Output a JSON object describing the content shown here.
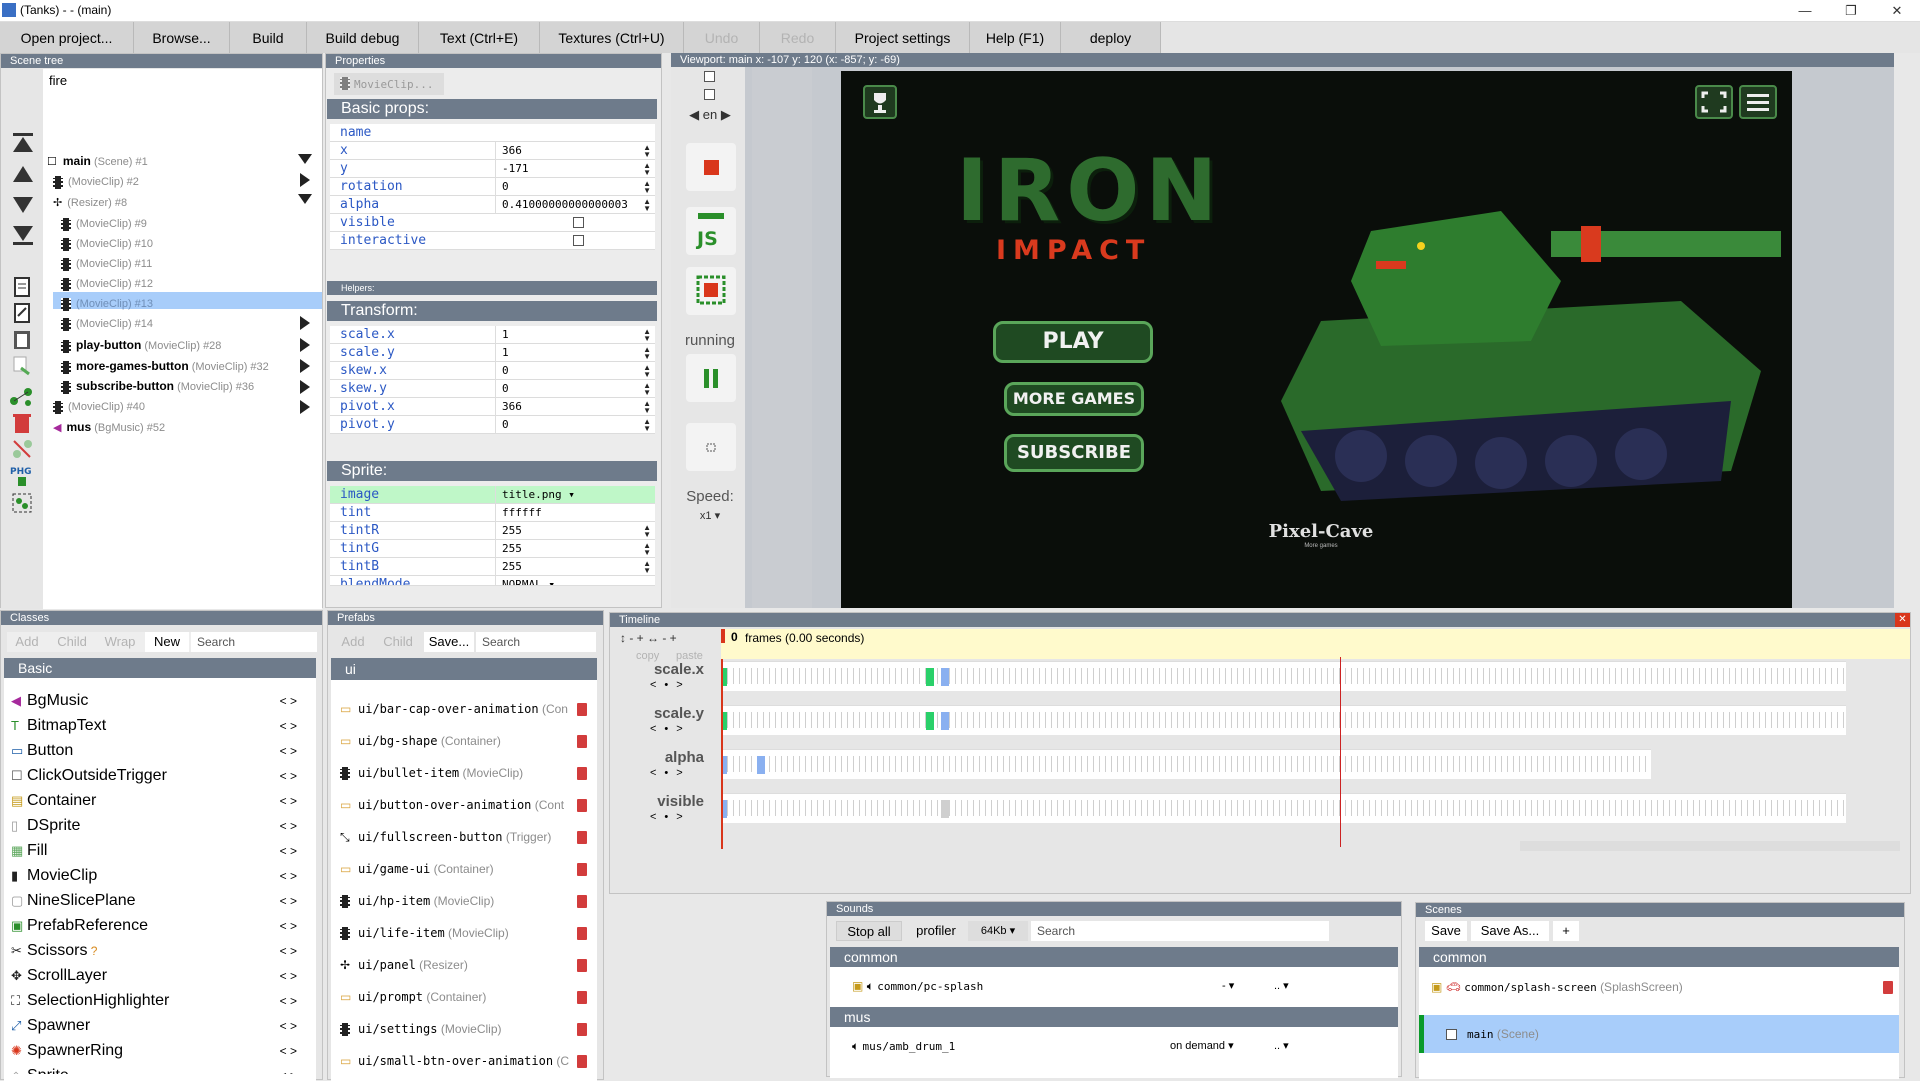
{
  "title": "(Tanks) - - (main)",
  "window_controls": [
    "—",
    "❐",
    "✕"
  ],
  "menu": [
    "Open project...",
    "Browse...",
    "Build",
    "Build debug",
    "Text (Ctrl+E)",
    "Textures (Ctrl+U)",
    "Undo",
    "Redo",
    "Project settings",
    "Help (F1)",
    "deploy"
  ],
  "scene_tree": {
    "header": "Scene tree",
    "search_value": "fire",
    "rows": [
      {
        "name": "main",
        "cls": "(Scene) #1"
      },
      {
        "name": "",
        "cls": "(MovieClip) #2"
      },
      {
        "name": "",
        "cls": "(Resizer) #8"
      },
      {
        "name": "",
        "cls": "(MovieClip) #9"
      },
      {
        "name": "",
        "cls": "(MovieClip) #10"
      },
      {
        "name": "",
        "cls": "(MovieClip) #11"
      },
      {
        "name": "",
        "cls": "(MovieClip) #12"
      },
      {
        "name": "",
        "cls": "(MovieClip) #13"
      },
      {
        "name": "",
        "cls": "(MovieClip) #14"
      },
      {
        "name": "play-button",
        "cls": "(MovieClip) #28"
      },
      {
        "name": "more-games-button",
        "cls": "(MovieClip) #32"
      },
      {
        "name": "subscribe-button",
        "cls": "(MovieClip) #36"
      },
      {
        "name": "",
        "cls": "(MovieClip) #40"
      },
      {
        "name": "mus",
        "cls": "(BgMusic) #52"
      }
    ]
  },
  "properties": {
    "header": "Properties",
    "tab": "MovieClip...",
    "basic_title": "Basic props:",
    "basic": [
      {
        "k": "name",
        "v": ""
      },
      {
        "k": "x",
        "v": "366"
      },
      {
        "k": "y",
        "v": "-171"
      },
      {
        "k": "rotation",
        "v": "0"
      },
      {
        "k": "alpha",
        "v": "0.41000000000000003"
      },
      {
        "k": "visible",
        "v": ""
      },
      {
        "k": "interactive",
        "v": ""
      }
    ],
    "helpers": "Helpers:",
    "transform_title": "Transform:",
    "transform": [
      {
        "k": "scale.x",
        "v": "1"
      },
      {
        "k": "scale.y",
        "v": "1"
      },
      {
        "k": "skew.x",
        "v": "0"
      },
      {
        "k": "skew.y",
        "v": "0"
      },
      {
        "k": "pivot.x",
        "v": "366"
      },
      {
        "k": "pivot.y",
        "v": "0"
      }
    ],
    "sprite_title": "Sprite:",
    "sprite": [
      {
        "k": "image",
        "v": "title.png ▾"
      },
      {
        "k": "tint",
        "v": "ffffff"
      },
      {
        "k": "tintR",
        "v": "255"
      },
      {
        "k": "tintG",
        "v": "255"
      },
      {
        "k": "tintB",
        "v": "255"
      },
      {
        "k": "blendMode",
        "v": "NORMAL ▾"
      }
    ]
  },
  "viewport": {
    "header": "Viewport: main x: -107 y: 120 (x: -857; y: -69)",
    "lang": "◀ en ▶",
    "running": "running",
    "speed_label": "Speed:",
    "speed_value": "x1 ▾",
    "game": {
      "title_big": "IRON",
      "title_small": "IMPACT",
      "play": "PLAY",
      "more": "MORE GAMES",
      "subscribe": "SUBSCRIBE",
      "brand": "Pixel-Cave",
      "brand_sub": "More games"
    }
  },
  "classes": {
    "header": "Classes",
    "tools": [
      "Add",
      "Child",
      "Wrap",
      "New"
    ],
    "search_placeholder": "Search",
    "group": "Basic",
    "items": [
      "BgMusic",
      "BitmapText",
      "Button",
      "ClickOutsideTrigger",
      "Container",
      "DSprite",
      "Fill",
      "MovieClip",
      "NineSlicePlane",
      "PrefabReference",
      "Scissors",
      "ScrollLayer",
      "SelectionHighlighter",
      "Spawner",
      "SpawnerRing",
      "Sprite"
    ]
  },
  "prefabs": {
    "header": "Prefabs",
    "tools": [
      "Add",
      "Child",
      "Save..."
    ],
    "search_placeholder": "Search",
    "group": "ui",
    "items": [
      {
        "n": "ui/bar-cap-over-animation",
        "c": "(Con"
      },
      {
        "n": "ui/bg-shape",
        "c": "(Container)"
      },
      {
        "n": "ui/bullet-item",
        "c": "(MovieClip)"
      },
      {
        "n": "ui/button-over-animation",
        "c": "(Cont"
      },
      {
        "n": "ui/fullscreen-button",
        "c": "(Trigger)"
      },
      {
        "n": "ui/game-ui",
        "c": "(Container)"
      },
      {
        "n": "ui/hp-item",
        "c": "(MovieClip)"
      },
      {
        "n": "ui/life-item",
        "c": "(MovieClip)"
      },
      {
        "n": "ui/panel",
        "c": "(Resizer)"
      },
      {
        "n": "ui/prompt",
        "c": "(Container)"
      },
      {
        "n": "ui/settings",
        "c": "(MovieClip)"
      },
      {
        "n": "ui/small-btn-over-animation",
        "c": "(C"
      }
    ]
  },
  "timeline": {
    "header": "Timeline",
    "frames": "0",
    "frames_label": "frames (0.00 seconds)",
    "copy": "copy",
    "paste": "paste",
    "tracks": [
      "scale.x",
      "scale.y",
      "alpha",
      "visible"
    ]
  },
  "sounds": {
    "header": "Sounds",
    "stop_all": "Stop all",
    "profiler": "profiler",
    "size": "64Kb ▾",
    "search_placeholder": "Search",
    "groups": [
      {
        "name": "common",
        "item": "common/pc-splash",
        "mode": "- ▾",
        "extra": ".. ▾"
      },
      {
        "name": "mus",
        "item": "mus/amb_drum_1",
        "mode": "on demand ▾",
        "extra": ".. ▾"
      }
    ]
  },
  "scenes": {
    "header": "Scenes",
    "save": "Save",
    "save_as": "Save As...",
    "add": "+",
    "group": "common",
    "items": [
      {
        "n": "common/splash-screen",
        "c": "(SplashScreen)"
      },
      {
        "n": "main",
        "c": "(Scene)"
      }
    ]
  },
  "colors": {
    "header": "#6e7b8b",
    "selection": "#a8cdfa",
    "game_green": "#2d7a2d",
    "game_red": "#d93a1e"
  }
}
